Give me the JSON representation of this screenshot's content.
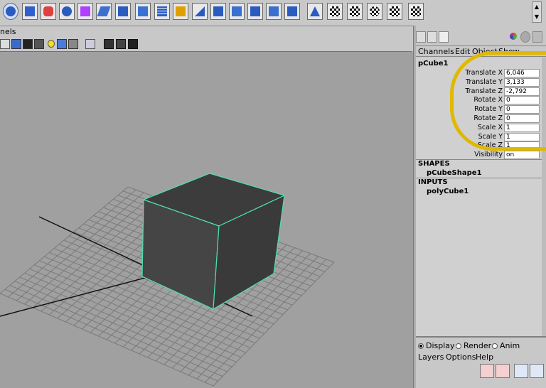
{
  "panel": {
    "menu_label": "nels"
  },
  "channel_box": {
    "menu": [
      "Channels",
      "Edit",
      "Object",
      "Show"
    ],
    "object_name": "pCube1",
    "attributes": [
      {
        "label": "Translate X",
        "value": "6,046"
      },
      {
        "label": "Translate Y",
        "value": "3,133"
      },
      {
        "label": "Translate Z",
        "value": "-2,792"
      },
      {
        "label": "Rotate X",
        "value": "0"
      },
      {
        "label": "Rotate Y",
        "value": "0"
      },
      {
        "label": "Rotate Z",
        "value": "0"
      },
      {
        "label": "Scale X",
        "value": "1"
      },
      {
        "label": "Scale Y",
        "value": "1"
      },
      {
        "label": "Scale Z",
        "value": "1"
      },
      {
        "label": "Visibility",
        "value": "on"
      }
    ],
    "shapes_title": "SHAPES",
    "shape_item": "pCubeShape1",
    "inputs_title": "INPUTS",
    "input_item": "polyCube1"
  },
  "layer_editor": {
    "radio": [
      {
        "label": "Display",
        "selected": true
      },
      {
        "label": "Render",
        "selected": false
      },
      {
        "label": "Anim",
        "selected": false
      }
    ],
    "menu": [
      "Layers",
      "Options",
      "Help"
    ]
  },
  "colors": {
    "viewport_bg": "#a0a0a0",
    "selection_wire": "#4ee0b0",
    "annotation": "#e0b800"
  }
}
